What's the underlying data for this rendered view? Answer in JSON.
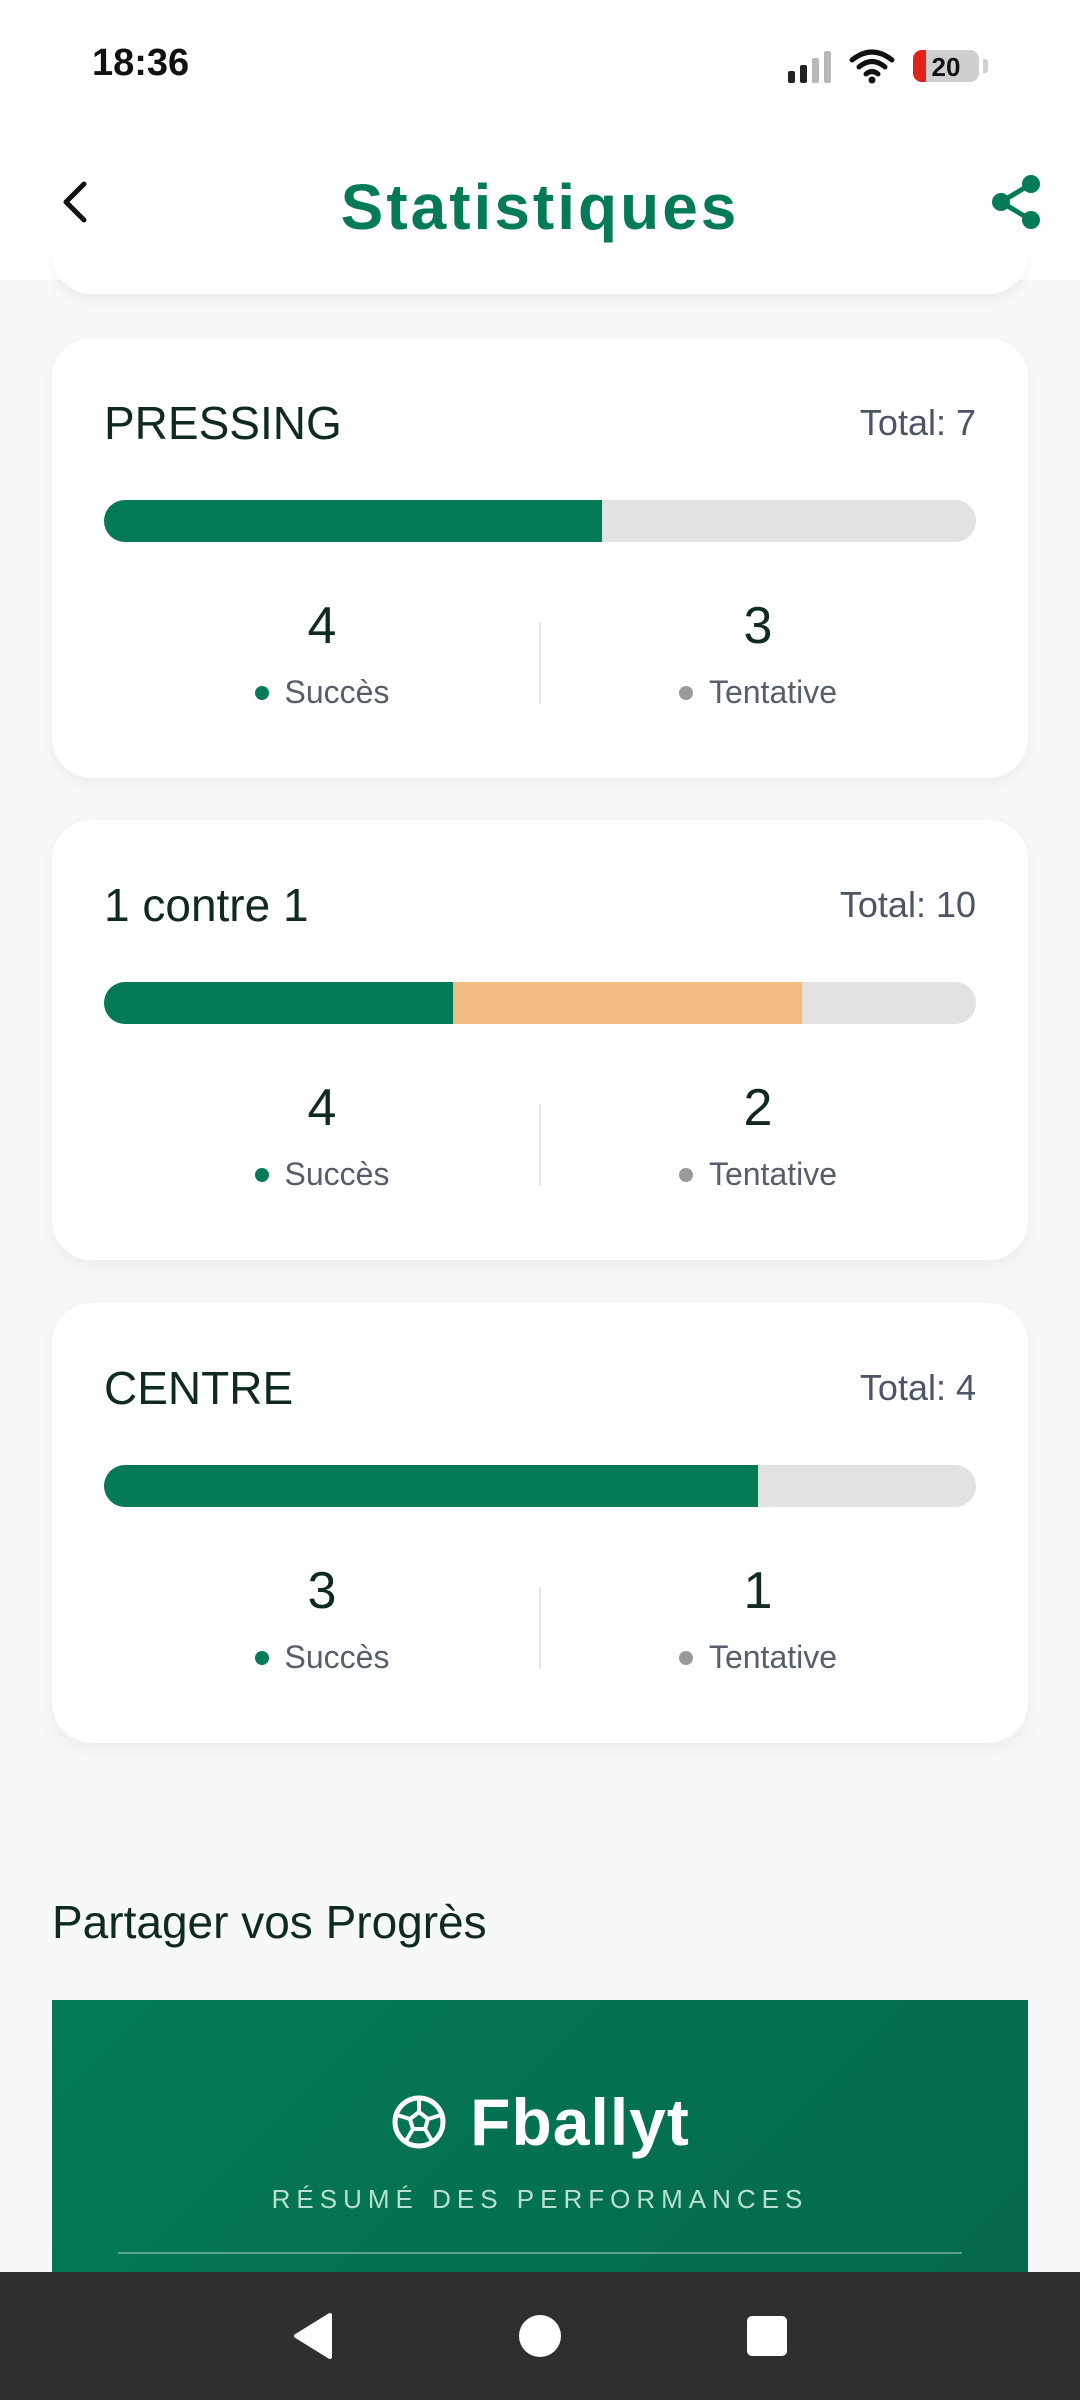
{
  "status_bar": {
    "time": "18:36",
    "battery": "20",
    "battery_level": 0.2,
    "icons": [
      "signal-icon",
      "wifi-icon",
      "battery-icon"
    ]
  },
  "header": {
    "title": "Statistiques",
    "back_icon": "chevron-left-icon",
    "share_icon": "share-icon"
  },
  "colors": {
    "brand": "#057a57",
    "success": "#057a57",
    "attempt_bar": "#f2bb84",
    "track": "#e2e2e2",
    "attempt_dot": "#9a9a9a"
  },
  "stats": [
    {
      "title": "PRESSING",
      "total": "Total: 7",
      "success_value": "4",
      "success_label": "Succès",
      "attempt_value": "3",
      "attempt_label": "Tentative",
      "success_fraction": 0.571,
      "attempt_fraction": 0.0
    },
    {
      "title": "1 contre 1",
      "total": "Total: 10",
      "success_value": "4",
      "success_label": "Succès",
      "attempt_value": "2",
      "attempt_label": "Tentative",
      "success_fraction": 0.4,
      "attempt_fraction": 0.4
    },
    {
      "title": "CENTRE",
      "total": "Total: 4",
      "success_value": "3",
      "success_label": "Succès",
      "attempt_value": "1",
      "attempt_label": "Tentative",
      "success_fraction": 0.75,
      "attempt_fraction": 0.0
    }
  ],
  "share_section": {
    "title": "Partager vos Progrès",
    "brand": "Fballyt",
    "brand_icon": "soccer-ball-icon",
    "subtitle": "RÉSUMÉ DES PERFORMANCES"
  },
  "nav_bar": {
    "icons": [
      "nav-back-icon",
      "nav-home-icon",
      "nav-recents-icon"
    ]
  }
}
